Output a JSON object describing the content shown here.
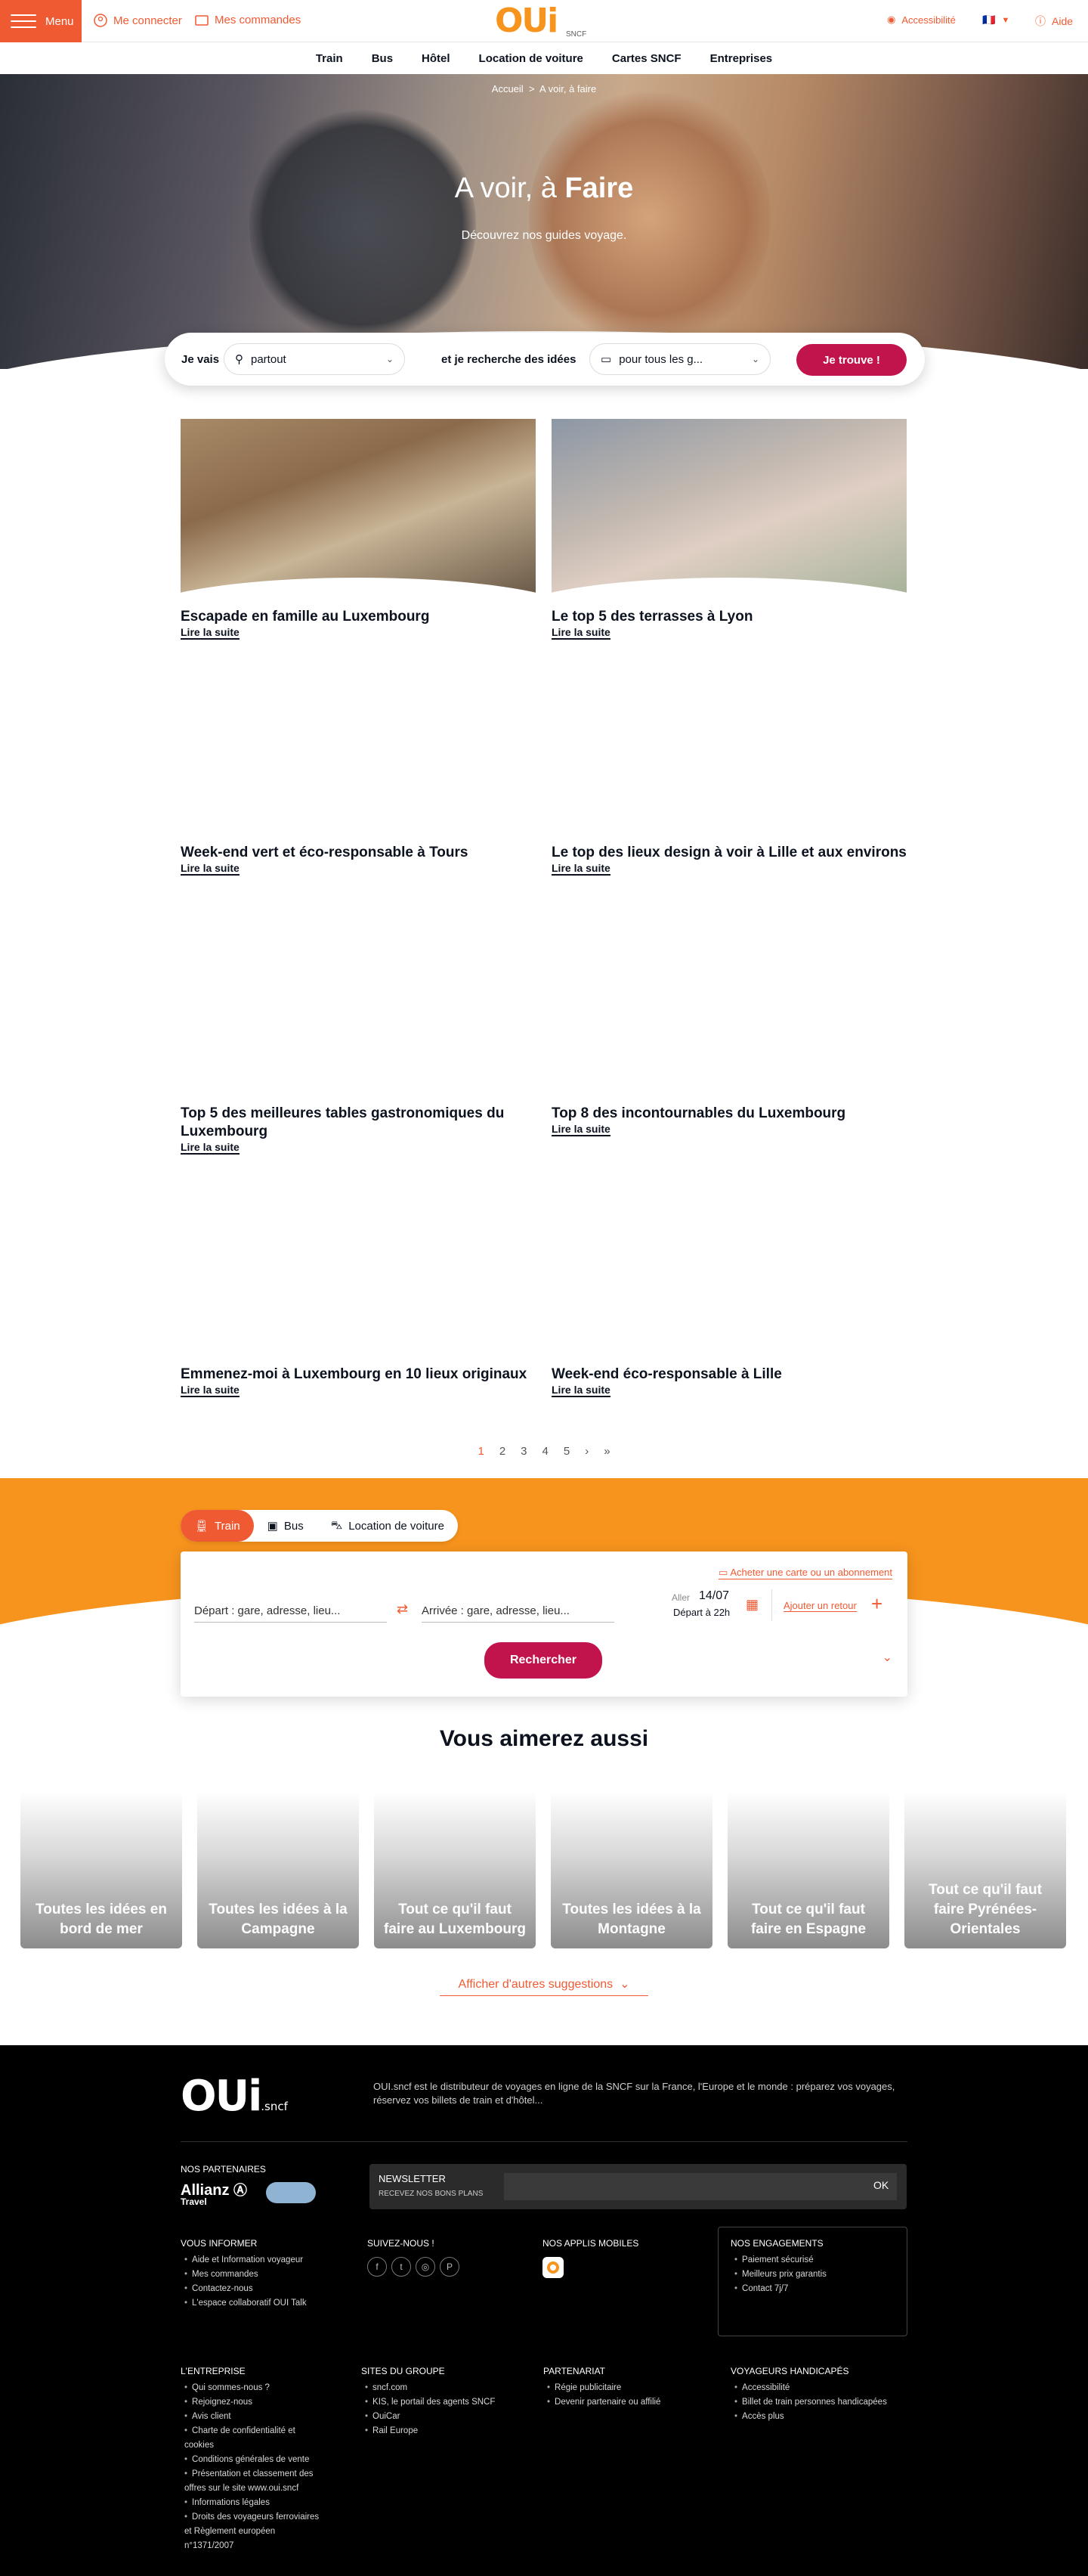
{
  "header": {
    "menu_label": "Menu",
    "login_label": "Me connecter",
    "orders_label": "Mes commandes",
    "logo_text": "OUi",
    "logo_sub": "SNCF",
    "accessibility_label": "Accessibilité",
    "help_label": "Aide",
    "flag": "🇫🇷"
  },
  "nav": [
    "Train",
    "Bus",
    "Hôtel",
    "Location de voiture",
    "Cartes SNCF",
    "Entreprises"
  ],
  "hero": {
    "breadcrumb_home": "Accueil",
    "breadcrumb_sep": ">",
    "breadcrumb_current": "A voir, à faire",
    "title_light": "A voir, à ",
    "title_bold": "Faire",
    "subtitle": "Découvrez nos guides voyage."
  },
  "search": {
    "going_label": "Je vais",
    "going_value": "partout",
    "ideas_label": "et je recherche des idées",
    "ideas_value": "pour tous les g...",
    "submit": "Je trouve !"
  },
  "articles": [
    {
      "title": "Escapade en famille au Luxembourg",
      "link": "Lire la suite"
    },
    {
      "title": "Le top 5 des terrasses à Lyon",
      "link": "Lire la suite"
    },
    {
      "title": "Week-end vert et éco-responsable à Tours",
      "link": "Lire la suite"
    },
    {
      "title": "Le top des lieux design à voir à Lille et aux environs",
      "link": "Lire la suite"
    },
    {
      "title": "Top 5 des meilleures tables gastronomiques du Luxembourg",
      "link": "Lire la suite"
    },
    {
      "title": "Top 8 des incontournables du Luxembourg",
      "link": "Lire la suite"
    },
    {
      "title": "Emmenez-moi à Luxembourg en 10 lieux originaux",
      "link": "Lire la suite"
    },
    {
      "title": "Week-end éco-responsable à Lille",
      "link": "Lire la suite"
    }
  ],
  "pagination": {
    "pages": [
      "1",
      "2",
      "3",
      "4",
      "5"
    ],
    "next": "›",
    "last": "»",
    "current": "1"
  },
  "booking": {
    "tabs": [
      "Train",
      "Bus",
      "Location de voiture"
    ],
    "card_link": "Acheter une carte ou un abonnement",
    "from_placeholder": "Départ : gare, adresse, lieu...",
    "to_placeholder": "Arrivée : gare, adresse, lieu...",
    "outbound_label": "Aller",
    "outbound_date": "14/07",
    "outbound_time": "Départ à 22h",
    "return_label": "Ajouter un retour",
    "submit": "Rechercher"
  },
  "suggestions": {
    "title_light": "Vous aimerez ",
    "title_bold": "aussi",
    "tiles": [
      "Toutes les idées en bord de mer",
      "Toutes les idées à la Campagne",
      "Tout ce qu'il faut faire au Luxembourg",
      "Toutes les idées à la Montagne",
      "Tout ce qu'il faut faire en Espagne",
      "Tout ce qu'il faut faire Pyrénées-Orientales"
    ],
    "more": "Afficher d'autres suggestions"
  },
  "footer": {
    "logo": "OUi",
    "logo_sub": ".sncf",
    "description": "OUI.sncf est le distributeur de voyages en ligne de la SNCF sur la France, l'Europe et le monde : préparez vos voyages, réservez vos billets de train et d'hôtel...",
    "partners_title": "NOS PARTENAIRES",
    "partner_name": "Allianz",
    "partner_sub": "Travel",
    "newsletter_title": "NEWSLETTER",
    "newsletter_sub": "RECEVEZ NOS BONS PLANS",
    "newsletter_ok": "OK",
    "inform_title": "VOUS INFORMER",
    "inform_items": [
      "Aide et Information voyageur",
      "Mes commandes",
      "Contactez-nous",
      "L'espace collaboratif OUI Talk"
    ],
    "follow_title": "SUIVEZ-NOUS !",
    "social": [
      "f",
      "t",
      "◎",
      "P"
    ],
    "apps_title": "NOS APPLIS MOBILES",
    "engage_title": "NOS ENGAGEMENTS",
    "engage_items": [
      "Paiement sécurisé",
      "Meilleurs prix garantis",
      "Contact 7j/7"
    ],
    "company_title": "L'ENTREPRISE",
    "company_items": [
      "Qui sommes-nous ?",
      "Rejoignez-nous",
      "Avis client",
      "Charte de confidentialité et cookies",
      "Conditions générales de vente",
      "Présentation et classement des offres sur le site www.oui.sncf",
      "Informations légales",
      "Droits des voyageurs ferroviaires et Règlement européen n°1371/2007"
    ],
    "group_title": "SITES DU GROUPE",
    "group_items": [
      "sncf.com",
      "KIS, le portail des agents SNCF",
      "OuiCar",
      "Rail Europe"
    ],
    "partnership_title": "PARTENARIAT",
    "partnership_items": [
      "Régie publicitaire",
      "Devenir partenaire ou affilié"
    ],
    "handicap_title": "VOYAGEURS HANDICAPÉS",
    "handicap_items": [
      "Accessibilité",
      "Billet de train personnes handicapées",
      "Accès plus"
    ]
  },
  "colors": {
    "brand_orange": "#f7941d",
    "accent": "#f05a33",
    "cta": "#c1144c"
  }
}
